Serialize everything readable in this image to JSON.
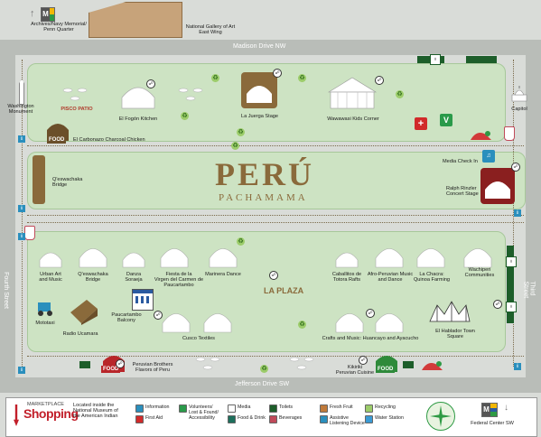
{
  "streets": {
    "top": "Madison Drive NW",
    "bottom": "Jefferson Drive SW",
    "left": "Fourth Street",
    "right": "Third Street"
  },
  "landmarks": {
    "archives": "Archives/Navy Memorial/\nPenn Quarter",
    "gallery": "National Gallery of Art\nEast Wing",
    "washington": "Washington\nMonument",
    "capitol": "Capitol",
    "federal": "Federal Center SW"
  },
  "metro_letter": "M",
  "title": "PERÚ",
  "subtitle": "PACHAMAMA",
  "plaza_label": "LA PLAZA",
  "food_label": "FOOD",
  "venues": {
    "pisco": "PISCO PATIO",
    "fogon": "El Fogón Kitchen",
    "juerga": "La Juerga Stage",
    "wawa": "Wawawasi Kids Corner",
    "carbonazo": "El Carbonazo Charcoal Chicken",
    "qeswachaka_bridge_top": "Q'eswachaka\nBridge",
    "media_checkin": "Media Check In",
    "rinzler": "Ralph Rinzler\nConcert Stage",
    "urban": "Urban Art\nand Music",
    "qeswachaka2": "Q'eswachaka\nBridge",
    "danza": "Danza\nSoraeja",
    "fiesta": "Fiesta de la\nVirgen del Carmen de\nPaucartambo",
    "marinera": "Marinera Dance",
    "caballitos": "Caballitos de\nTotora Rafts",
    "afro": "Afro-Peruvian Music\nand Dance",
    "chacra": "La Chacra:\nQuinoa Farming",
    "wachiperi": "Wachiperi\nCommunities",
    "mototaxi": "Mototaxi",
    "radio": "Radio Ucamara",
    "paucartambo": "Paucartambo\nBalcony",
    "cusco": "Cusco Textiles",
    "crafts": "Crafts and Music: Huancayo and Ayacucho",
    "hablador": "El Hablador Town Square",
    "brothers": "Peruvian Brothers\nFlavors of Peru",
    "kikiriki": "Kikiriki\nPeruvian Cuisine"
  },
  "marketplace": {
    "small": "MARKETPLACE",
    "big": "Shopping",
    "desc": "Located inside the\nNational Museum of\nthe American Indian"
  },
  "legend": [
    {
      "icon": "information-icon",
      "label": "Information",
      "color": "#2a8fbd"
    },
    {
      "icon": "first-aid-icon",
      "label": "First Aid",
      "color": "#d12a2a"
    },
    {
      "icon": "volunteers-icon",
      "label": "Volunteers/\nLost & Found/\nAccessibility",
      "color": "#2a9a4a"
    },
    {
      "icon": "media-icon",
      "label": "Media",
      "color": "#ffffff"
    },
    {
      "icon": "food-drink-icon",
      "label": "Food & Drink",
      "color": "#1d6f5c"
    },
    {
      "icon": "toilets-icon",
      "label": "Toilets",
      "color": "#1d5e2a"
    },
    {
      "icon": "beverages-icon",
      "label": "Beverages",
      "color": "#c04a5a"
    },
    {
      "icon": "fresh-fruit-icon",
      "label": "Fresh Fruit",
      "color": "#c07a3a"
    },
    {
      "icon": "listening-device-icon",
      "label": "Assistive\nListening Device",
      "color": "#2a8fbd"
    },
    {
      "icon": "recycling-icon",
      "label": "Recycling",
      "color": "#9ccc6a"
    },
    {
      "icon": "water-station-icon",
      "label": "Water Station",
      "color": "#3a9ad4"
    }
  ],
  "colors": {
    "brown": "#6b4f2a",
    "green_area": "#cde3c3",
    "food_red": "#b8262a",
    "road": "#b9bdb8"
  }
}
